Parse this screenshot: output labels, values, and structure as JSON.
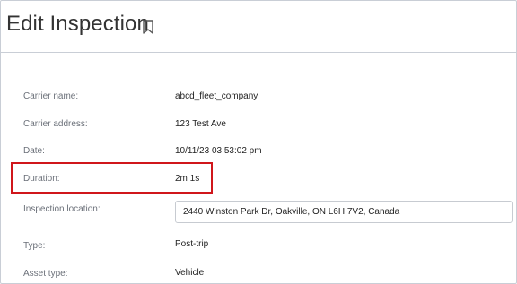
{
  "header": {
    "title": "Edit Inspection",
    "bookmark_icon": "bookmark-icon"
  },
  "fields": {
    "carrier_name": {
      "label": "Carrier name:",
      "value": "abcd_fleet_company"
    },
    "carrier_address": {
      "label": "Carrier address:",
      "value": "123 Test Ave"
    },
    "date": {
      "label": "Date:",
      "value": "10/11/23 03:53:02 pm"
    },
    "duration": {
      "label": "Duration:",
      "value": "2m 1s"
    },
    "inspection_location": {
      "label": "Inspection location:",
      "value": "2440 Winston Park Dr, Oakville, ON L6H 7V2, Canada"
    },
    "type": {
      "label": "Type:",
      "value": "Post-trip"
    },
    "asset_type": {
      "label": "Asset type:",
      "value": "Vehicle"
    }
  },
  "colors": {
    "highlight": "#d0161b",
    "border": "#c9ced6",
    "label": "#6b7079"
  }
}
